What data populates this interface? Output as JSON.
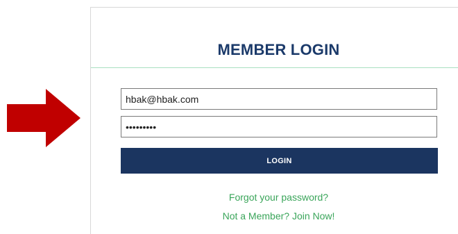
{
  "colors": {
    "title": "#1b3a6a",
    "button": "#1b3560",
    "link": "#3aa55a",
    "arrow": "#c00000",
    "divider": "#a9dfc0"
  },
  "pointer": {
    "icon": "right-arrow-icon"
  },
  "login": {
    "title": "MEMBER LOGIN",
    "email_value": "hbak@hbak.com",
    "password_value": "password1",
    "button_label": "LOGIN",
    "forgot_link": "Forgot your password?",
    "join_link": "Not a Member? Join Now!"
  }
}
